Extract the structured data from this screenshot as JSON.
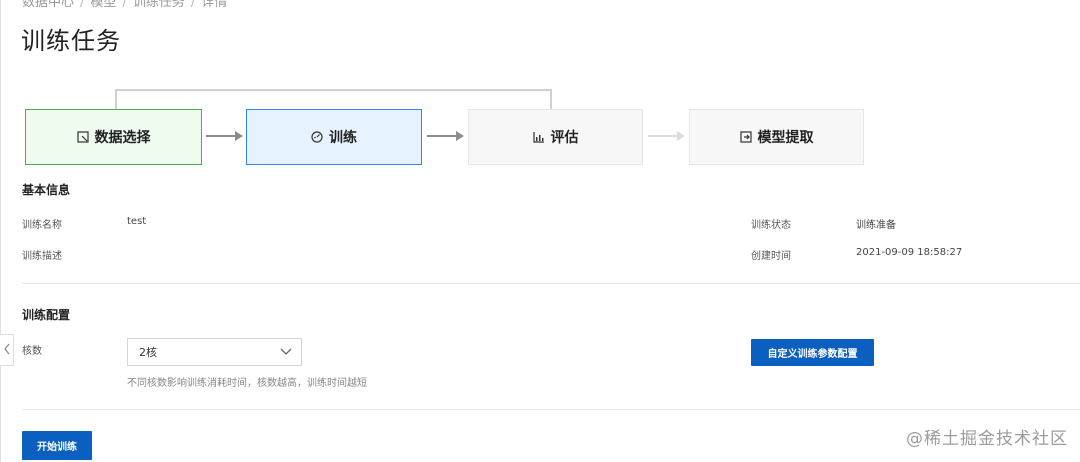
{
  "breadcrumb": [
    "数据中心",
    "模型",
    "训练任务",
    "详情"
  ],
  "page": {
    "title": "训练任务"
  },
  "flow": {
    "steps": [
      {
        "label": "数据选择",
        "icon": "data-select-icon",
        "status": "done",
        "color": "#46b04b"
      },
      {
        "label": "训练",
        "icon": "train-icon",
        "status": "active",
        "color": "#2f8ae5"
      },
      {
        "label": "评估",
        "icon": "chart-icon",
        "status": "pending",
        "color": "#e6e6e8"
      },
      {
        "label": "模型提取",
        "icon": "export-icon",
        "status": "pending",
        "color": "#e6e6e8"
      }
    ]
  },
  "basic_info": {
    "title": "基本信息",
    "name_label": "训练名称",
    "name_value": "test",
    "desc_label": "训练描述",
    "desc_value": "",
    "status_label": "训练状态",
    "status_value": "训练准备",
    "created_label": "创建时间",
    "created_value": "2021-09-09 18:58:27"
  },
  "config": {
    "title": "训练配置",
    "cores_label": "核数",
    "cores_value": "2核",
    "hint": "不同核数影响训练消耗时间，核数越高，训练时间越短",
    "custom_button": "自定义训练参数配置"
  },
  "actions": {
    "start_button": "开始训练"
  },
  "watermark": "@稀土掘金技术社区",
  "colors": {
    "primary": "#0a5fc0",
    "done_border": "#46b04b",
    "active_border": "#2f8ae5"
  }
}
